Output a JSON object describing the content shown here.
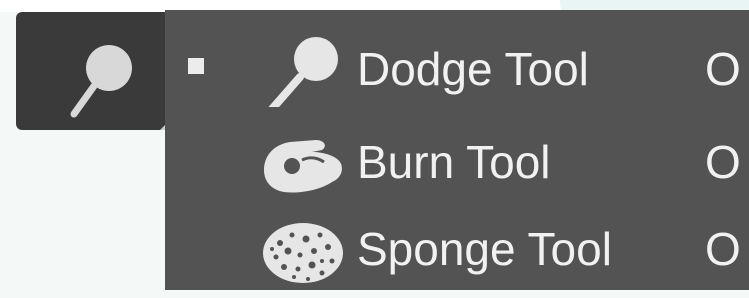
{
  "tool_button": {
    "icon": "dodge-tool-icon",
    "has_flyout_indicator": true
  },
  "flyout": {
    "items": [
      {
        "label": "Dodge Tool",
        "shortcut": "O",
        "icon": "dodge-tool-icon",
        "selected": true
      },
      {
        "label": "Burn Tool",
        "shortcut": "O",
        "icon": "burn-tool-icon",
        "selected": false
      },
      {
        "label": "Sponge Tool",
        "shortcut": "O",
        "icon": "sponge-tool-icon",
        "selected": false
      }
    ]
  },
  "colors": {
    "menu_background": "#535353",
    "button_background": "#3a3a3a",
    "text": "#f1f1f1",
    "icon": "#e6e6e6"
  }
}
